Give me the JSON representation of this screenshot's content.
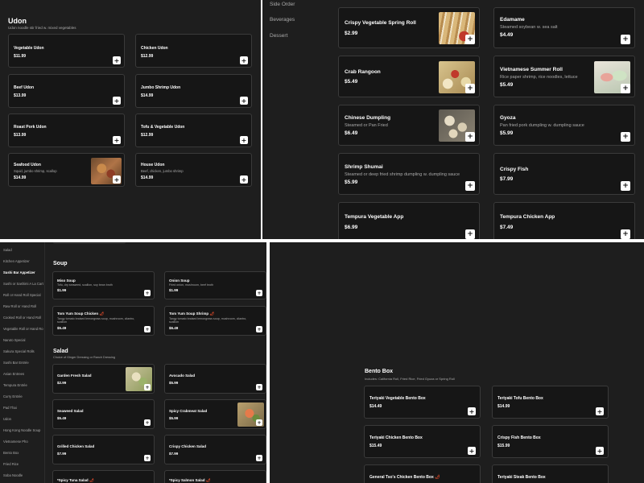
{
  "add_label": "+",
  "accent_spice": "#e04a2a",
  "p1": {
    "title": "Udon",
    "subtitle": "Udon noodle stir fried w. mixed vegetables",
    "items": [
      {
        "name": "Vegetable Udon",
        "desc": "",
        "price": "$11.99"
      },
      {
        "name": "Chicken Udon",
        "desc": "",
        "price": "$12.99"
      },
      {
        "name": "Beef Udon",
        "desc": "",
        "price": "$13.99"
      },
      {
        "name": "Jumbo Shrimp Udon",
        "desc": "",
        "price": "$14.99"
      },
      {
        "name": "Roast Pork Udon",
        "desc": "",
        "price": "$13.99"
      },
      {
        "name": "Tofu & Vegetable Udon",
        "desc": "",
        "price": "$12.99"
      },
      {
        "name": "Seafood Udon",
        "desc": "Squid, jumbo shrimp, scallop",
        "price": "$14.99"
      },
      {
        "name": "House Udon",
        "desc": "Beef, chicken, jumbo shrimp",
        "price": "$14.99"
      }
    ]
  },
  "p2": {
    "nav": [
      "Side Order",
      "Beverages",
      "Dessert"
    ],
    "items": [
      {
        "name": "Crispy Vegetable Spring Roll",
        "desc": "",
        "price": "$2.99"
      },
      {
        "name": "Edamame",
        "desc": "Steamed soybean w. sea salt",
        "price": "$4.49"
      },
      {
        "name": "Crab Rangoon",
        "desc": "",
        "price": "$5.49"
      },
      {
        "name": "Vietnamese Summer Roll",
        "desc": "Rice paper shrimp, rice noodles, lettuce",
        "price": "$5.49"
      },
      {
        "name": "Chinese Dumpling",
        "desc": "Steamed or Pan Fried",
        "price": "$6.49"
      },
      {
        "name": "Gyoza",
        "desc": "Pan fried pork dumpling w. dumpling sauce",
        "price": "$5.99"
      },
      {
        "name": "Shrimp Shumai",
        "desc": "Steamed or deep fried shrimp dumpling w. dumpling sauce",
        "price": "$5.99"
      },
      {
        "name": "Crispy Fish",
        "desc": "",
        "price": "$7.99"
      },
      {
        "name": "Tempura Vegetable App",
        "desc": "",
        "price": "$6.99"
      },
      {
        "name": "Tempura Chicken App",
        "desc": "",
        "price": "$7.49"
      }
    ]
  },
  "p3": {
    "nav": [
      "Salad",
      "Kitchen Appetizer",
      "Sushi Bar Appetizer",
      "Sushi or Sashimi A La Cart",
      "Roll or Hand Roll Special",
      "Raw Roll or Hand Roll",
      "Cooked Roll or Hand Roll",
      "Vegetable Roll or Hand Ro",
      "Naruto Special",
      "Sakura Special Rolls",
      "Sushi Bar Entrée",
      "Asian Entrees",
      "Tempura Entrée",
      "Curry Entrée",
      "Pad Thai",
      "Udon",
      "Hong Kong Noodle Soup",
      "Vietnamese Pho",
      "Bento Box",
      "Fried Rice",
      "Soba Noodle"
    ],
    "soup_title": "Soup",
    "salad_title": "Salad",
    "salad_sub": "Choice of Ginger Dressing or Ranch Dressing",
    "soups": [
      {
        "name": "Miso Soup",
        "desc": "Tofu, dry seaweed, scallion, soy bean broth",
        "price": "$1.99"
      },
      {
        "name": "Onion Soup",
        "desc": "Fried onion, mushroom, beef broth",
        "price": "$1.99"
      },
      {
        "name": "Tom Yum Soup Chicken",
        "desc": "Tangy tomato braised lemongrass soup, mushroom, cilantro, scallion",
        "price": "$5.49"
      },
      {
        "name": "Tom Yum Soup Shrimp",
        "desc": "Tangy tomato braised lemongrass soup, mushroom, cilantro, scallion",
        "price": "$6.49"
      }
    ],
    "salads": [
      {
        "name": "Garden Fresh Salad",
        "desc": "",
        "price": "$2.99"
      },
      {
        "name": "Avocado Salad",
        "desc": "",
        "price": "$5.99"
      },
      {
        "name": "Seaweed Salad",
        "desc": "",
        "price": "$5.49"
      },
      {
        "name": "Spicy Crabmeat Salad",
        "desc": "",
        "price": "$5.99"
      },
      {
        "name": "Grilled Chicken Salad",
        "desc": "",
        "price": "$7.99"
      },
      {
        "name": "Crispy Chicken Salad",
        "desc": "",
        "price": "$7.99"
      },
      {
        "name": "*Spicy Tuna Salad",
        "desc": "",
        "price": ""
      },
      {
        "name": "*Spicy Salmon Salad",
        "desc": "",
        "price": ""
      }
    ]
  },
  "p4": {
    "title": "Bento Box",
    "subtitle": "Includes: California Roll, Fried Rice, Fried Gyoza or Spring Roll",
    "items": [
      {
        "name": "Teriyaki Vegetable Bento Box",
        "price": "$14.49"
      },
      {
        "name": "Teriyaki Tofu Bento Box",
        "price": "$14.99"
      },
      {
        "name": "Teriyaki Chicken Bento Box",
        "price": "$15.49"
      },
      {
        "name": "Crispy Fish Bento Box",
        "price": "$15.99"
      },
      {
        "name": "General Tso's Chicken Bento Box",
        "price": ""
      },
      {
        "name": "Teriyaki Steak Bento Box",
        "price": ""
      }
    ]
  }
}
